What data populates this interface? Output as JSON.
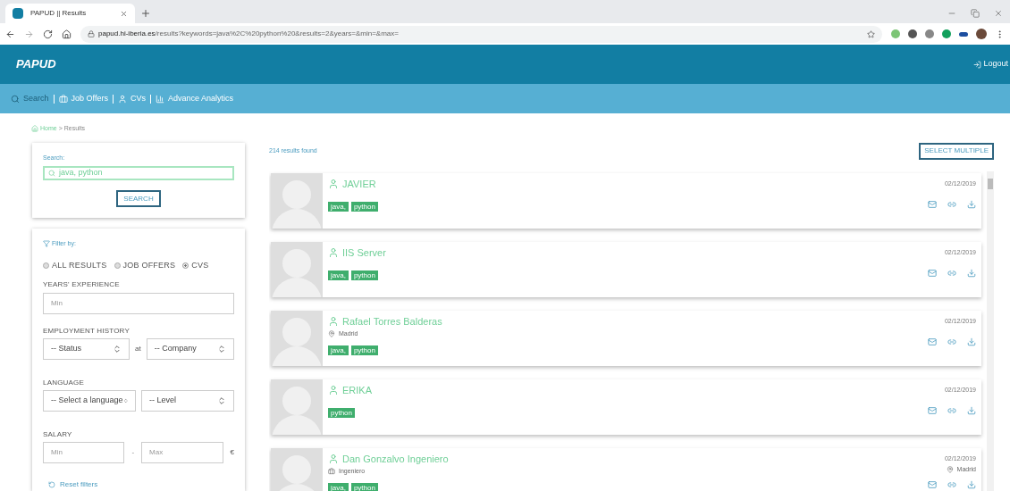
{
  "browser": {
    "tab_title": "PAPUD || Results",
    "url_host": "papud.hi-iberia.es",
    "url_path": "/results?keywords=java%2C%20python%20&results=2&years=&min=&max="
  },
  "header": {
    "logo": "PAPUD",
    "logout": "Logout"
  },
  "nav": [
    {
      "label": "Search",
      "selected": true
    },
    {
      "label": "Job Offers",
      "selected": false
    },
    {
      "label": "CVs",
      "selected": false
    },
    {
      "label": "Advance Analytics",
      "selected": false
    }
  ],
  "breadcrumb": {
    "home": "Home",
    "separator": ">",
    "current": "Results"
  },
  "search": {
    "label": "Search:",
    "value": "java, python",
    "button": "SEARCH"
  },
  "filters": {
    "title": "Filter by:",
    "scope": [
      {
        "label": "ALL RESULTS",
        "selected": false
      },
      {
        "label": "JOB OFFERS",
        "selected": false
      },
      {
        "label": "CVS",
        "selected": true
      }
    ],
    "years_label": "YEARS' EXPERIENCE",
    "years_placeholder": "Min",
    "employment_label": "EMPLOYMENT HISTORY",
    "status": "-- Status",
    "at": "at",
    "company": "-- Company",
    "language_label": "LANGUAGE",
    "language": "-- Select a language",
    "level": "-- Level",
    "salary_label": "SALARY",
    "salary_min": "Min",
    "salary_sep": "-",
    "salary_max": "Max",
    "currency": "€",
    "reset": "Reset filters"
  },
  "results": {
    "count": "214 results found",
    "select_multiple": "SELECT MULTIPLE",
    "items": [
      {
        "name": "JAVIER",
        "tags": [
          "java,",
          "python"
        ],
        "date": "02/12/2019"
      },
      {
        "name": "IIS Server",
        "tags": [
          "java,",
          "python"
        ],
        "date": "02/12/2019"
      },
      {
        "name": "Rafael Torres Balderas",
        "detail": {
          "kind": "location",
          "text": "Madrid"
        },
        "tags": [
          "java,",
          "python"
        ],
        "date": "02/12/2019"
      },
      {
        "name": "ERIKA",
        "tags": [
          "python"
        ],
        "date": "02/12/2019"
      },
      {
        "name": "Dan Gonzalvo Ingeniero",
        "detail": {
          "kind": "job",
          "text": "Ingeniero"
        },
        "side_location": "Madrid",
        "tags": [
          "java,",
          "python"
        ],
        "date": "02/12/2019"
      }
    ]
  }
}
